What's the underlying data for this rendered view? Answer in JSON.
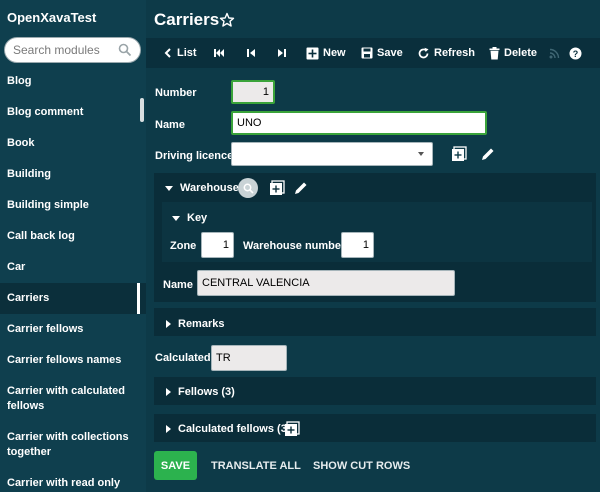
{
  "app": {
    "title": "OpenXavaTest"
  },
  "search": {
    "placeholder": "Search modules"
  },
  "modules": [
    {
      "label": "Blog",
      "lines": 1
    },
    {
      "label": "Blog comment",
      "lines": 1
    },
    {
      "label": "Book",
      "lines": 1
    },
    {
      "label": "Building",
      "lines": 1
    },
    {
      "label": "Building simple",
      "lines": 1
    },
    {
      "label": "Call back log",
      "lines": 1
    },
    {
      "label": "Car",
      "lines": 1
    },
    {
      "label": "Carriers",
      "lines": 1,
      "active": true
    },
    {
      "label": "Carrier fellows",
      "lines": 1
    },
    {
      "label": "Carrier fellows names",
      "lines": 1
    },
    {
      "label": "Carrier with calculated fellows",
      "lines": 2
    },
    {
      "label": "Carrier with collections together",
      "lines": 2
    },
    {
      "label": "Carrier with read only",
      "lines": 1
    }
  ],
  "page": {
    "title": "Carriers"
  },
  "toolbar": {
    "list": "List",
    "new": "New",
    "save": "Save",
    "refresh": "Refresh",
    "delete": "Delete"
  },
  "form": {
    "number_label": "Number",
    "number_value": "1",
    "name_label": "Name",
    "name_value": "UNO",
    "driving_licence_label": "Driving licence",
    "driving_licence_value": "",
    "warehouse_label": "Warehouse",
    "key_label": "Key",
    "zone_label": "Zone",
    "zone_value": "1",
    "warehouse_number_label": "Warehouse number",
    "warehouse_number_value": "1",
    "warehouse_name_label": "Name",
    "warehouse_name_value": "CENTRAL VALENCIA",
    "remarks_label": "Remarks",
    "calculated_label": "Calculated",
    "calculated_value": "TR",
    "fellows_label": "Fellows (3)",
    "calculated_fellows_label": "Calculated fellows (3)"
  },
  "actions": {
    "save": "SAVE",
    "translate_all": "TRANSLATE ALL",
    "show_cut_rows": "SHOW CUT ROWS"
  },
  "colors": {
    "sidebar_bg": "#0f3f4e",
    "main_bg": "#0d3a48",
    "save_green": "#2cb24e"
  }
}
